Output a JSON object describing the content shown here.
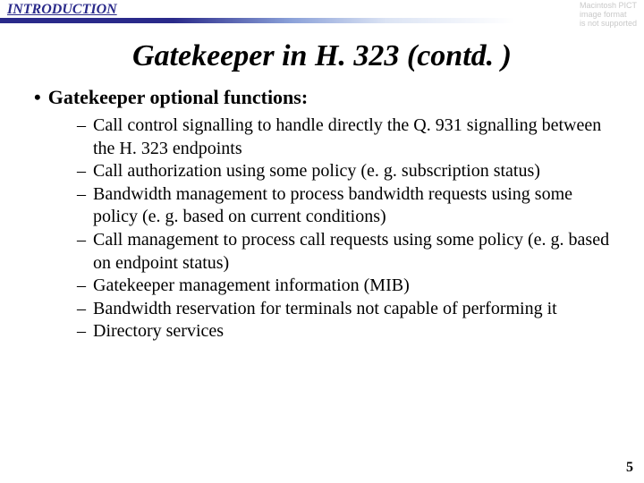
{
  "header": {
    "section_label": "INTRODUCTION",
    "watermark_line1": "Macintosh PICT",
    "watermark_line2": "image format",
    "watermark_line3": "is not supported"
  },
  "title": "Gatekeeper in H. 323 (contd. )",
  "bullet_main": {
    "marker": "•",
    "text": "Gatekeeper optional functions:"
  },
  "sub_marker": "–",
  "subitems": [
    "Call control signalling to handle directly the Q. 931 signalling between the H. 323 endpoints",
    "Call authorization using some policy (e. g. subscription status)",
    "Bandwidth management to process bandwidth requests using some policy (e. g. based on current conditions)",
    "Call management to process call requests using some policy (e. g. based on endpoint status)",
    "Gatekeeper management information (MIB)",
    "Bandwidth reservation for terminals not capable of performing it",
    "Directory services"
  ],
  "page_number": "5"
}
